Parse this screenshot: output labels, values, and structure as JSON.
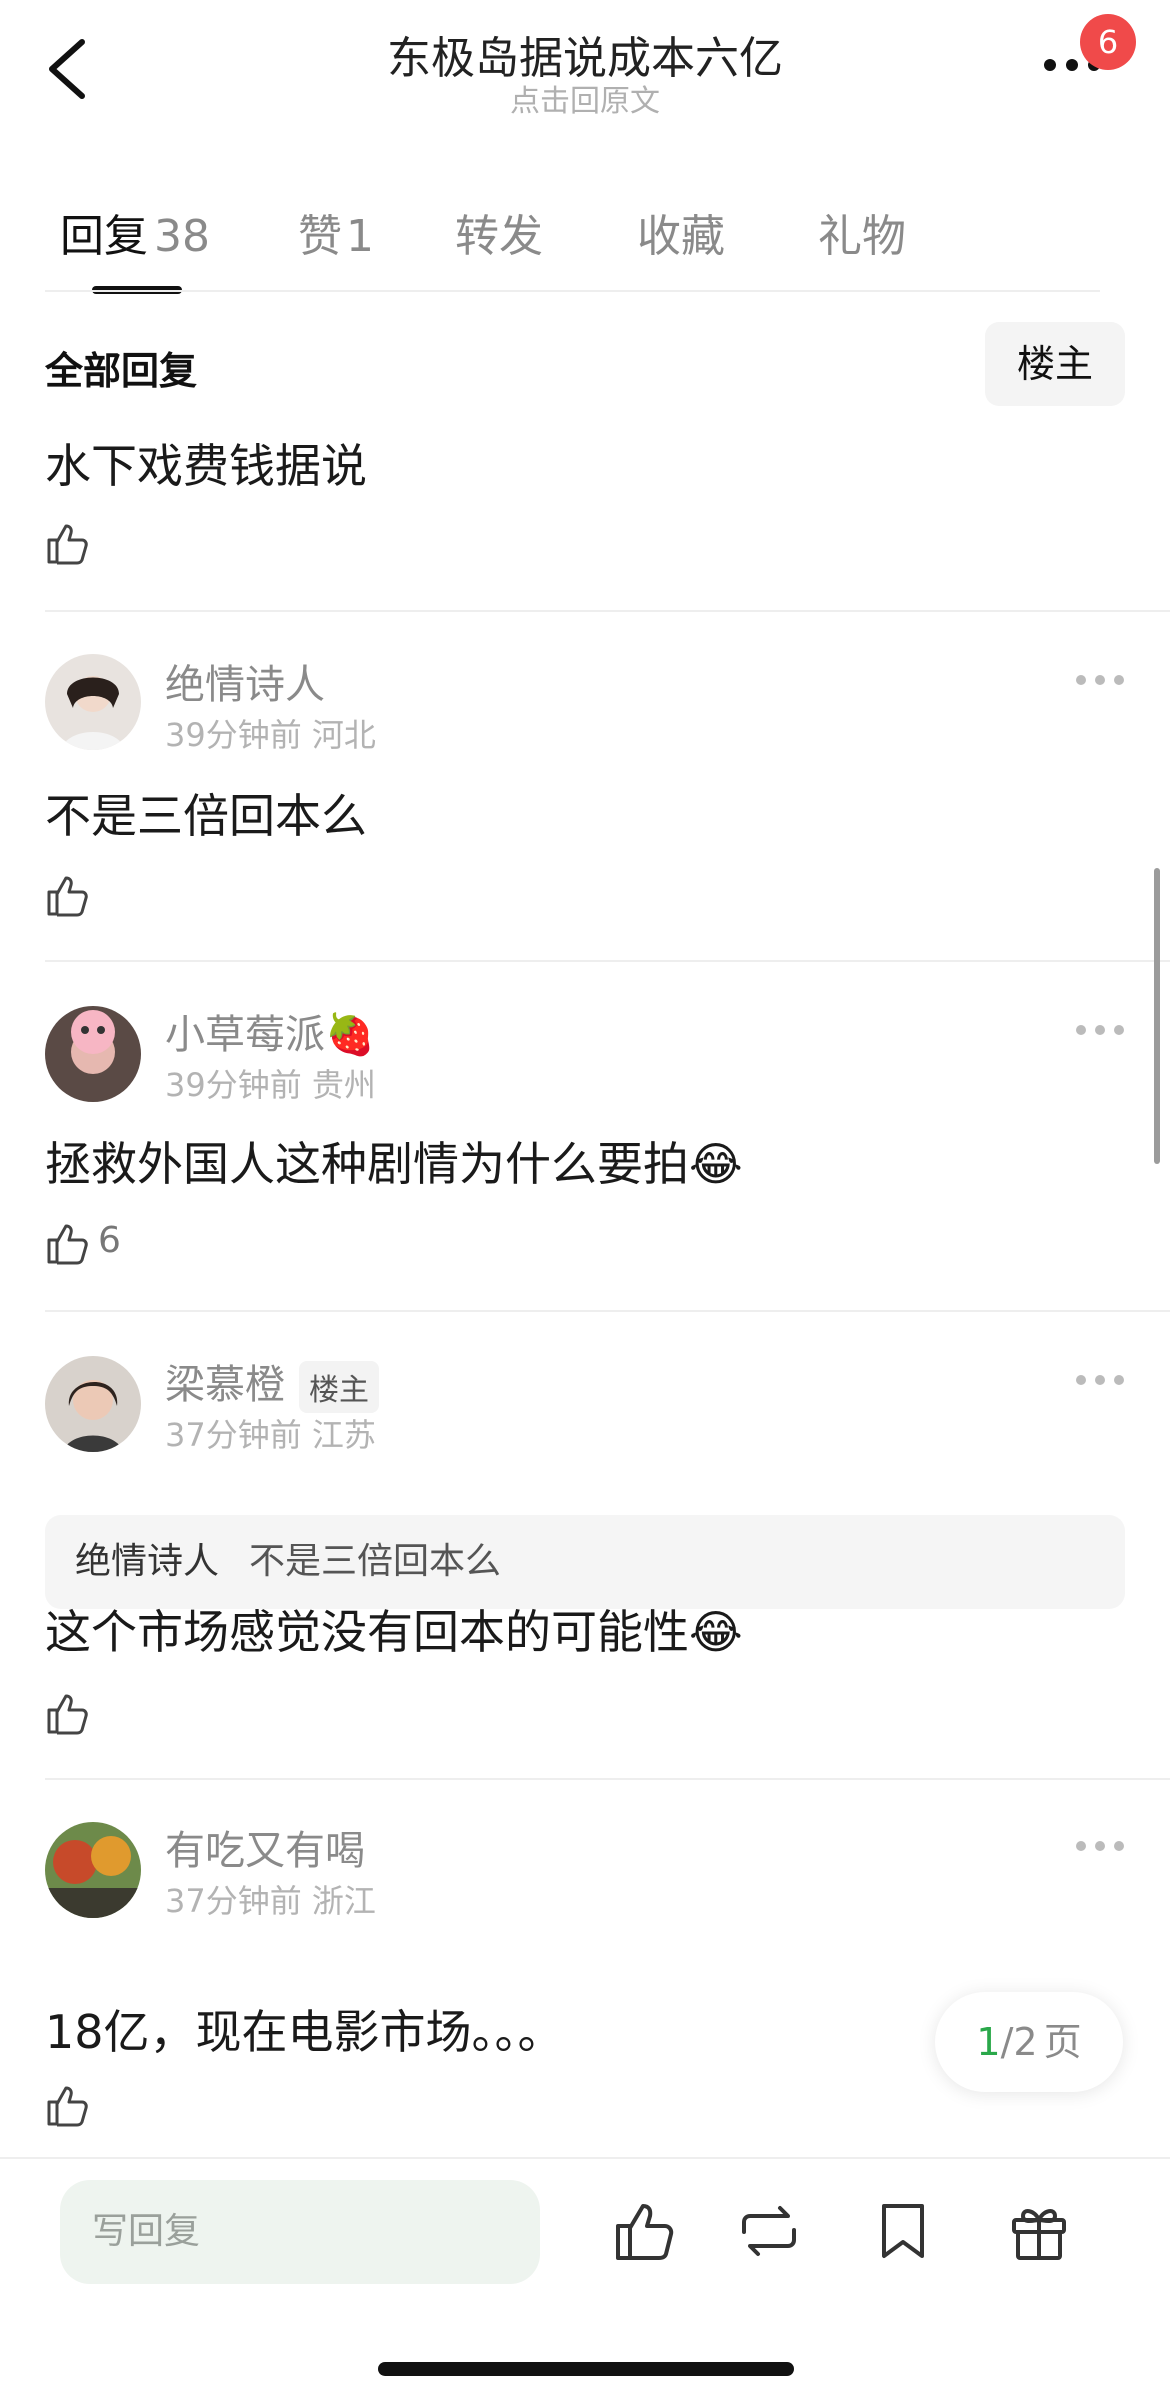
{
  "header": {
    "title": "东极岛据说成本六亿",
    "subtitle": "点击回原文",
    "notification_count": "6"
  },
  "tabs": [
    {
      "label": "回复",
      "count": "38",
      "active": true
    },
    {
      "label": "赞",
      "count": "1"
    },
    {
      "label": "转发",
      "count": ""
    },
    {
      "label": "收藏",
      "count": ""
    },
    {
      "label": "礼物",
      "count": ""
    }
  ],
  "section": {
    "title": "全部回复",
    "filter_button": "楼主"
  },
  "first_reply": {
    "content": "水下戏费钱据说"
  },
  "comments": [
    {
      "name": "绝情诗人",
      "time": "39分钟前",
      "location": "河北",
      "content": "不是三倍回本么",
      "likes": ""
    },
    {
      "name": "小草莓派",
      "name_emoji": "🍓",
      "time": "39分钟前",
      "location": "贵州",
      "content": "拯救外国人这种剧情为什么要拍",
      "content_emoji": "😂",
      "likes": "6"
    },
    {
      "name": "梁慕橙",
      "badge": "楼主",
      "time": "37分钟前",
      "location": "江苏",
      "quote_user": "绝情诗人",
      "quote_text": "不是三倍回本么",
      "content": "这个市场感觉没有回本的可能性",
      "content_emoji": "😂",
      "likes": ""
    },
    {
      "name": "有吃又有喝",
      "time": "37分钟前",
      "location": "浙江",
      "content": "18亿，现在电影市场。。。",
      "likes": ""
    }
  ],
  "pager": {
    "current": "1",
    "total": "/2",
    "unit": "页"
  },
  "bottom": {
    "reply_placeholder": "写回复"
  },
  "colors": {
    "accent_green": "#2aa84a",
    "badge_red": "#f04a4a"
  }
}
